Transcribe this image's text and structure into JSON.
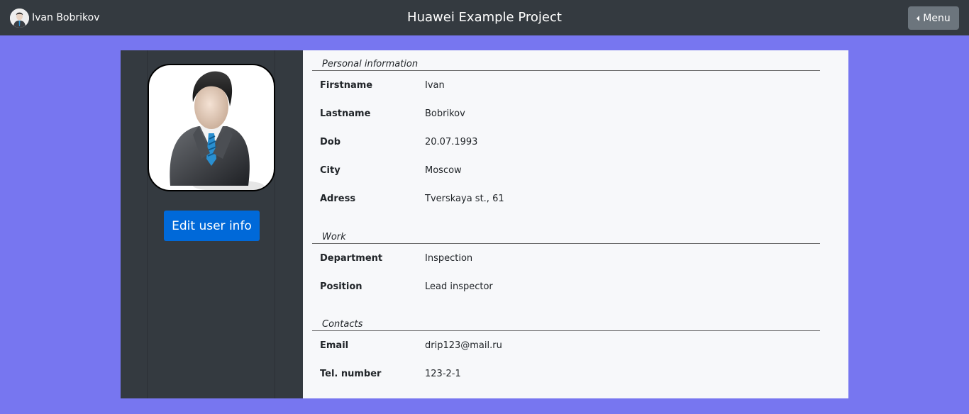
{
  "navbar": {
    "user_name": "Ivan Bobrikov",
    "title": "Huawei Example Project",
    "menu_label": "Menu",
    "menu_icon": "caret-left-icon"
  },
  "sidebar": {
    "photo_icon": "businessman-avatar",
    "edit_button_label": "Edit user info"
  },
  "sections": {
    "personal": {
      "title": "Personal information",
      "rows": [
        {
          "label": "Firstname",
          "value": "Ivan"
        },
        {
          "label": "Lastname",
          "value": "Bobrikov"
        },
        {
          "label": "Dob",
          "value": "20.07.1993"
        },
        {
          "label": "City",
          "value": "Moscow"
        },
        {
          "label": "Adress",
          "value": "Tverskaya st., 61"
        }
      ]
    },
    "work": {
      "title": "Work",
      "rows": [
        {
          "label": "Department",
          "value": "Inspection"
        },
        {
          "label": "Position",
          "value": "Lead inspector"
        }
      ]
    },
    "contacts": {
      "title": "Contacts",
      "rows": [
        {
          "label": "Email",
          "value": "drip123@mail.ru"
        },
        {
          "label": "Tel. number",
          "value": "123-2-1"
        }
      ]
    }
  },
  "colors": {
    "page_background": "#7776f0",
    "navbar": "#343a40",
    "primary_button": "#0069d9",
    "secondary_button": "#6c757d",
    "panel": "#f7f8fa"
  }
}
